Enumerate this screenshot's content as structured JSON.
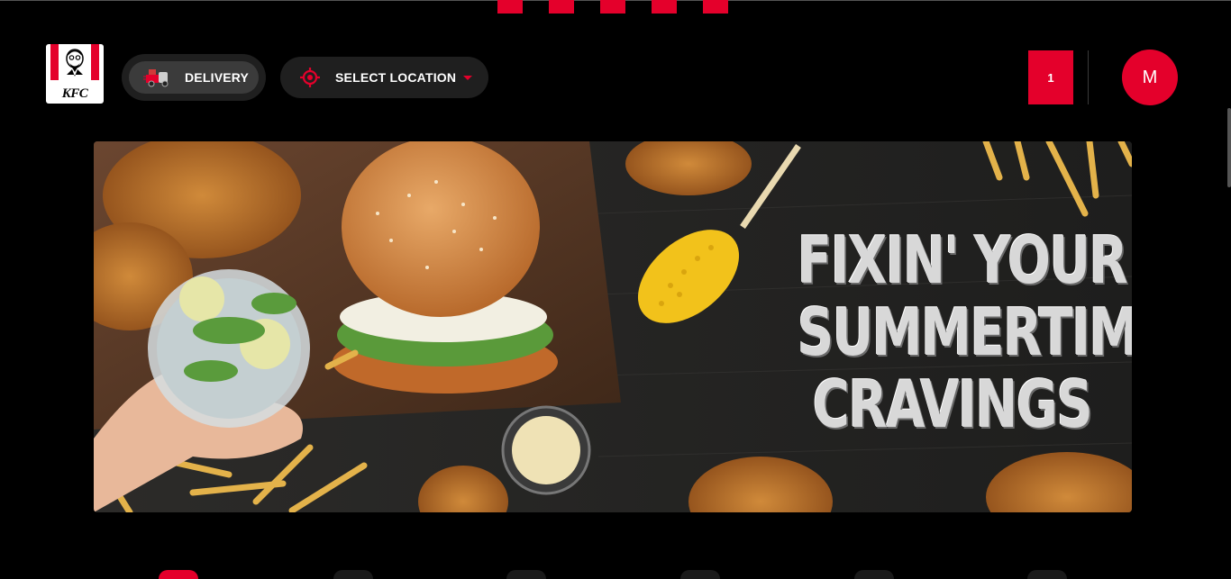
{
  "brand": {
    "logo_text": "KFC"
  },
  "header": {
    "delivery_label": "DELIVERY",
    "location_label": "SELECT LOCATION",
    "cart_count": "1",
    "avatar_initial": "M"
  },
  "banner": {
    "headline": [
      "FIXIN' YOUR",
      "SUMMERTIME",
      "CRAVINGS"
    ]
  },
  "colors": {
    "accent": "#e4002b",
    "background": "#000000",
    "pill": "#1f1f1f"
  },
  "icons": [
    "delivery-truck-icon",
    "location-target-icon",
    "chevron-down-icon"
  ]
}
